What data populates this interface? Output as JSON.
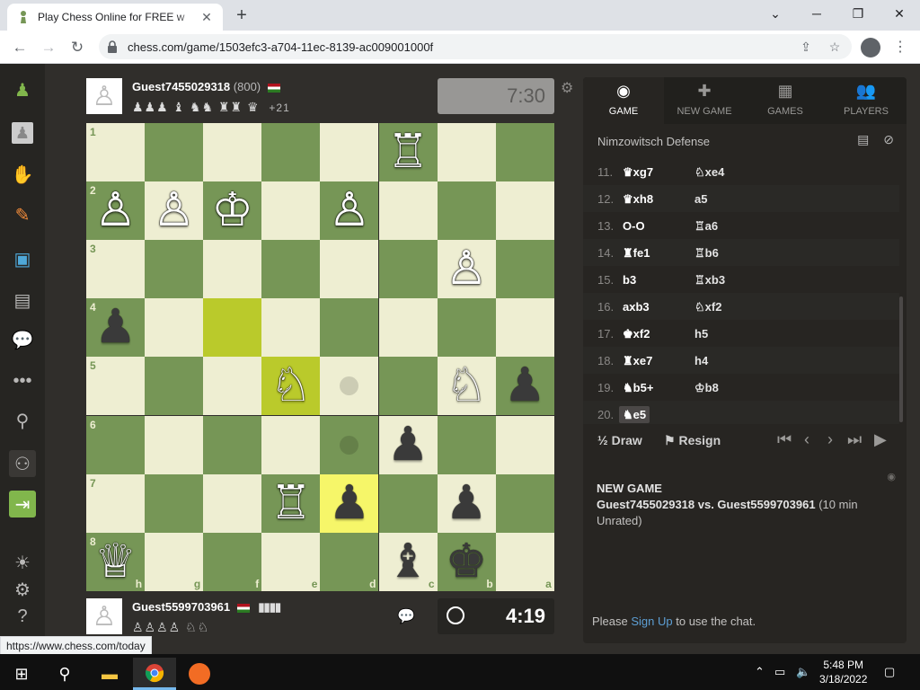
{
  "browser": {
    "tab_title": "Play Chess Online for FREE w",
    "new_tab": "+",
    "url": "chess.com/game/1503efc3-a704-11ec-8139-ac009001000f",
    "status_url": "https://www.chess.com/today"
  },
  "top_player": {
    "name": "Guest7455029318",
    "rating": "(800)",
    "captured": "♟♟♟ ♝ ♞♞ ♜♜ ♛",
    "advantage": "+21",
    "clock": "7:30"
  },
  "bottom_player": {
    "name": "Guest5599703961",
    "captured": "♙♙♙♙ ♘♘",
    "clock": "4:19"
  },
  "board": {
    "ranks": [
      "1",
      "2",
      "3",
      "4",
      "5",
      "6",
      "7",
      "8"
    ],
    "files": [
      "h",
      "g",
      "f",
      "e",
      "d",
      "c",
      "b",
      "a"
    ]
  },
  "panel": {
    "tabs": [
      {
        "label": "GAME",
        "icon": "◉"
      },
      {
        "label": "NEW GAME",
        "icon": "✚"
      },
      {
        "label": "GAMES",
        "icon": "▦"
      },
      {
        "label": "PLAYERS",
        "icon": "👥"
      }
    ],
    "opening": "Nimzowitsch Defense",
    "moves": [
      {
        "n": "11.",
        "w": "♛xg7",
        "b": "♘xe4"
      },
      {
        "n": "12.",
        "w": "♛xh8",
        "b": "a5"
      },
      {
        "n": "13.",
        "w": "O-O",
        "b": "♖a6"
      },
      {
        "n": "14.",
        "w": "♜fe1",
        "b": "♖b6"
      },
      {
        "n": "15.",
        "w": "b3",
        "b": "♖xb3"
      },
      {
        "n": "16.",
        "w": "axb3",
        "b": "♘xf2"
      },
      {
        "n": "17.",
        "w": "♚xf2",
        "b": "h5"
      },
      {
        "n": "18.",
        "w": "♜xe7",
        "b": "h4"
      },
      {
        "n": "19.",
        "w": "♞b5+",
        "b": "♔b8"
      },
      {
        "n": "20.",
        "w": "♞e5",
        "b": ""
      }
    ],
    "draw_label": "Draw",
    "draw_prefix": "½",
    "resign_label": "Resign",
    "newgame_title": "NEW GAME",
    "newgame_players": "Guest7455029318 vs. Guest5599703961",
    "newgame_mode": "(10 min Unrated)",
    "chat_prefix": "Please ",
    "chat_link": "Sign Up",
    "chat_suffix": " to use the chat."
  },
  "taskbar": {
    "time": "5:48 PM",
    "date": "3/18/2022"
  },
  "colors": {
    "light_square": "#eeeed2",
    "dark_square": "#769656",
    "highlight": "#f6f669",
    "link": "#5d9fd4"
  }
}
